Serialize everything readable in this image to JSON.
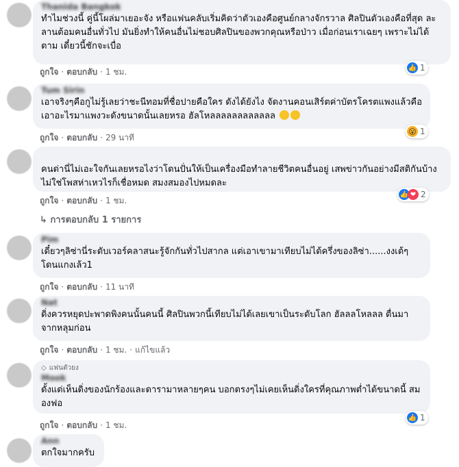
{
  "comments": [
    {
      "author": "Thanida Bangkok",
      "text": "ทำไมช่วงนี้ คู่นี้โผล่มาเยอะจัง หรือแฟนคลับเริ่มคิดว่าตัวเองคือศูนย์กลางจักรวาล ศิลปินตัวเองคือที่สุด ละลานต้อมคนอื่นทั่วไป มันยิ่งทำให้คนอื่นไม่ชอบศิลปินของพวกคุณหรือป่าว เมื่อก่อนเราเฉยๆ เพราะไม่ได้ตาม เดี๋ยวนี้ชักจะเบื่อ",
      "like": "ถูกใจ",
      "reply": "ตอบกลับ",
      "time": "1 ชม.",
      "reaction_count": "1"
    },
    {
      "author": "Tum Sirin",
      "text": "เอาจริงๆคือกูไม่รู้เลยว่าชะนีทอมที่ชื่อปายคือใคร ดังได้ยังไง จัดงานคอนเสิร์ตค่าบัตรโครตแพงแล้วคือเอาอะไรมาแพงวะดังขนาดนั้นเลยหรอ ฮัลโหลลลลลลลลลลลล",
      "like": "ถูกใจ",
      "reply": "ตอบกลับ",
      "time": "29 นาที",
      "reaction_count": "1"
    },
    {
      "author": "",
      "text": "คนด่านี่ไม่เอะใจกันเลยหรอไงว่าโดนปั่นให้เป็นเครื่องมือทำลายชีวิตคนอื่นอยู่ เสพข่าวกันอย่างมีสติกันบ้างไม่ใช่โพสห่าเหวไรก็เชื่อหมด สมงสมองไปหมดละ",
      "like": "ถูกใจ",
      "reply": "ตอบกลับ",
      "time": "1 ชม.",
      "reaction_count": "2",
      "replies_link": "การตอบกลับ 1 รายการ"
    },
    {
      "author": "Pim",
      "text": "เดี๋ยวๆลิซ่านี่ระดับเวอร์คลาสนะรู้จักกันทั่วไปสากล แต่เอาเขามาเทียบไม่ได้ครึ่งของลิซ่า......งงเต้ๆโดนแกงเล้ว1",
      "like": "ถูกใจ",
      "reply": "ตอบกลับ",
      "time": "11 นาที"
    },
    {
      "author": "Nat",
      "text": "ดิ่งควรหยุดปะพาดพิงคนนั้นคนนี้ ศิลปินพวกนี้เทียบไม่ได้เลยเขาเป็นระดับโลก ฮัลลลโหลลล ตื่นมาจากหลุมก่อน",
      "like": "ถูกใจ",
      "reply": "ตอบกลับ",
      "time": "1 ชม.",
      "edited": "แก้ไขแล้ว"
    },
    {
      "badge": "แฟนตัวยง",
      "author": "Mook",
      "text": "ดั้งแต่เห็นดิ่งของนักร้องและดารามาหลายๆคน บอกตรงๆไม่เคยเห็นดิ่งใครที่คุณภาพต่ำได้ขนาดนี้ สมองฟอ",
      "like": "ถูกใจ",
      "reply": "ตอบกลับ",
      "time": "1 ชม.",
      "reaction_count": "1"
    },
    {
      "author": "Ann",
      "text": "ตกใจมากครับ"
    }
  ],
  "colors": {
    "bubble": "#f0f2f5",
    "meta": "#65676b",
    "like_blue": "#1877f2"
  },
  "icons": [
    "like-icon",
    "wow-icon",
    "love-icon",
    "reply-arrow-icon",
    "diamond-icon"
  ]
}
